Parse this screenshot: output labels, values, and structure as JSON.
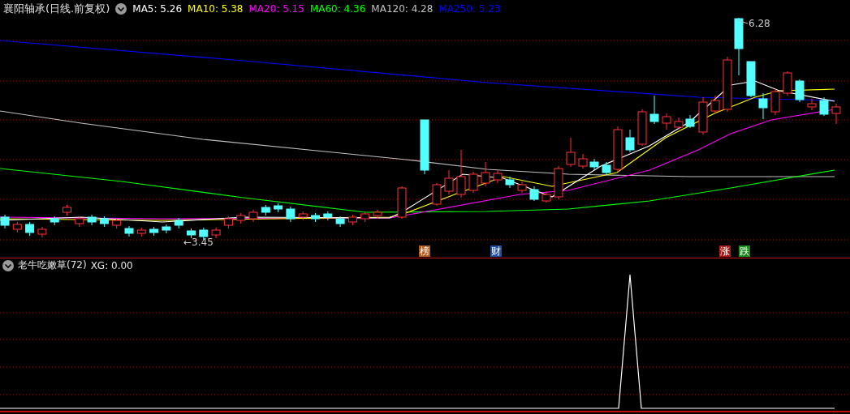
{
  "stock": {
    "title": "襄阳轴承(日线.前复权)",
    "indicators": [
      {
        "label": "MA5: 5.26",
        "color": "#ffffff"
      },
      {
        "label": "MA10: 5.38",
        "color": "#ffff00"
      },
      {
        "label": "MA20: 5.15",
        "color": "#ff00ff"
      },
      {
        "label": "MA60: 4.36",
        "color": "#00ff00"
      },
      {
        "label": "MA120: 4.28",
        "color": "#c0c0c0"
      },
      {
        "label": "MA250: 5.23",
        "color": "#0000ff"
      }
    ]
  },
  "chart": {
    "high_label": "6.28",
    "low_label": "←3.45",
    "events": [
      {
        "text": "榜",
        "color": "#b05a1e"
      },
      {
        "text": "财",
        "color": "#1e4fa0"
      },
      {
        "text": "涨",
        "color": "#b01818"
      },
      {
        "text": "跌",
        "color": "#1a8a1a"
      }
    ]
  },
  "indicator_panel": {
    "title": "老牛吃嫩草(72)",
    "reading": "XG: 0.00"
  }
}
